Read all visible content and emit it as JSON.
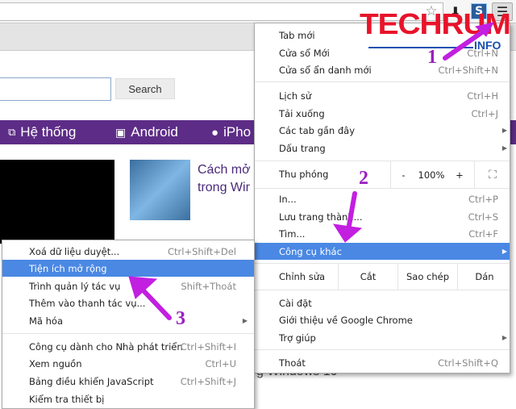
{
  "browser": {
    "icons": [
      "star-icon",
      "download-icon",
      "s-extension-icon",
      "menu-icon"
    ]
  },
  "page": {
    "search_button": "Search",
    "nav": [
      {
        "icon": "network-icon",
        "label": "Hệ thống"
      },
      {
        "icon": "android-icon",
        "label": "Android"
      },
      {
        "icon": "apple-icon",
        "label": "iPho"
      }
    ],
    "article_title_line1": "Cách mở",
    "article_title_line2": "trong Wir",
    "behind_text": "g Windows 10",
    "nav_color": "#5d2c87"
  },
  "logo": {
    "text": "TECHRUM",
    "sub": "INFO"
  },
  "annotations": {
    "step1": "1",
    "step2": "2",
    "step3": "3",
    "arrow_color": "#c21fe0"
  },
  "main_menu": {
    "group1": [
      {
        "label": "Tab mới",
        "shortcut": ""
      },
      {
        "label": "Cửa sổ Mới",
        "shortcut": "Ctrl+N"
      },
      {
        "label": "Cửa sổ ẩn danh mới",
        "shortcut": "Ctrl+Shift+N"
      }
    ],
    "group2": [
      {
        "label": "Lịch sử",
        "shortcut": "Ctrl+H"
      },
      {
        "label": "Tải xuống",
        "shortcut": "Ctrl+J"
      },
      {
        "label": "Các tab gần đây",
        "shortcut": ""
      },
      {
        "label": "Dấu trang",
        "shortcut": ""
      }
    ],
    "zoom": {
      "label": "Thu phóng",
      "minus": "-",
      "value": "100%",
      "plus": "+"
    },
    "group3": [
      {
        "label": "In...",
        "shortcut": "Ctrl+P"
      },
      {
        "label": "Lưu trang thành...",
        "shortcut": "Ctrl+S"
      },
      {
        "label": "Tìm...",
        "shortcut": "Ctrl+F"
      },
      {
        "label": "Công cụ khác",
        "shortcut": ""
      }
    ],
    "edit": {
      "label": "Chỉnh sửa",
      "cut": "Cắt",
      "copy": "Sao chép",
      "paste": "Dán"
    },
    "group4": [
      {
        "label": "Cài đặt"
      },
      {
        "label": "Giới thiệu về Google Chrome"
      },
      {
        "label": "Trợ giúp"
      }
    ],
    "exit": {
      "label": "Thoát",
      "shortcut": "Ctrl+Shift+Q"
    },
    "highlight_color": "#4a88e4"
  },
  "sub_menu": {
    "group1": [
      {
        "label": "Xoá dữ liệu duyệt...",
        "shortcut": "Ctrl+Shift+Del"
      },
      {
        "label": "Tiện ích mở rộng",
        "shortcut": ""
      },
      {
        "label": "Trình quản lý tác vụ",
        "shortcut": "Shift+Thoát"
      },
      {
        "label": "Thêm vào thanh tác vụ...",
        "shortcut": ""
      },
      {
        "label": "Mã hóa",
        "shortcut": ""
      }
    ],
    "group2": [
      {
        "label": "Công cụ dành cho Nhà phát triển",
        "shortcut": "Ctrl+Shift+I"
      },
      {
        "label": "Xem nguồn",
        "shortcut": "Ctrl+U"
      },
      {
        "label": "Bảng điều khiển JavaScript",
        "shortcut": "Ctrl+Shift+J"
      },
      {
        "label": "Kiểm tra thiết bị",
        "shortcut": ""
      }
    ]
  }
}
